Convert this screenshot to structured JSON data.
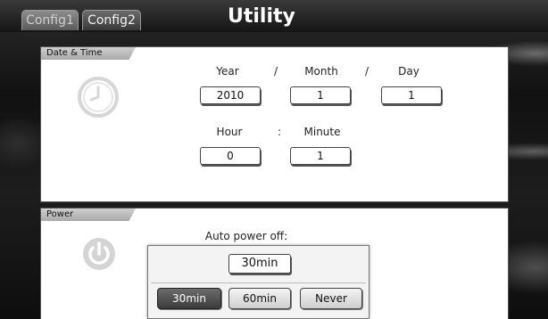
{
  "header": {
    "title": "Utility",
    "tabs": [
      {
        "label": "Config1",
        "active": false
      },
      {
        "label": "Config2",
        "active": true
      }
    ]
  },
  "date_time": {
    "section_label": "Date & Time",
    "icon": "clock-icon",
    "year_label": "Year",
    "month_label": "Month",
    "day_label": "Day",
    "date_separator": "/",
    "year": "2010",
    "month": "1",
    "day": "1",
    "hour_label": "Hour",
    "minute_label": "Minute",
    "time_separator": ":",
    "hour": "0",
    "minute": "1"
  },
  "power": {
    "section_label": "Power",
    "icon": "power-icon",
    "auto_power_off_label": "Auto power off:",
    "current_value": "30min",
    "options": [
      {
        "label": "30min",
        "selected": true
      },
      {
        "label": "60min",
        "selected": false
      },
      {
        "label": "Never",
        "selected": false
      }
    ]
  }
}
